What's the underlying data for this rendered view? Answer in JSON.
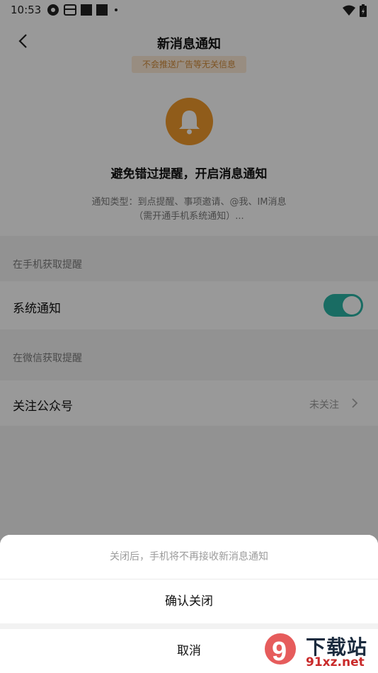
{
  "status_bar": {
    "time": "10:53"
  },
  "header": {
    "title": "新消息通知"
  },
  "ad_note": "不会推送广告等无关信息",
  "hero": {
    "headline": "避免错过提醒，开启消息通知",
    "desc_line1": "通知类型：到点提醒、事项邀请、@我、IM消息",
    "desc_line2": "（需开通手机系统通知）..."
  },
  "section_phone": {
    "title": "在手机获取提醒"
  },
  "system_notice": {
    "label": "系统通知",
    "enabled": true
  },
  "section_wechat": {
    "title": "在微信获取提醒"
  },
  "follow_account": {
    "label": "关注公众号",
    "status": "未关注"
  },
  "sheet": {
    "hint": "关闭后，手机将不再接收新消息通知",
    "confirm": "确认关闭",
    "cancel": "取消"
  },
  "colors": {
    "accent_orange": "#f19a2c",
    "toggle_teal": "#2bb5a5"
  },
  "watermark": {
    "text": "下载站",
    "url": "91xz.net",
    "logo_mark": "9"
  }
}
